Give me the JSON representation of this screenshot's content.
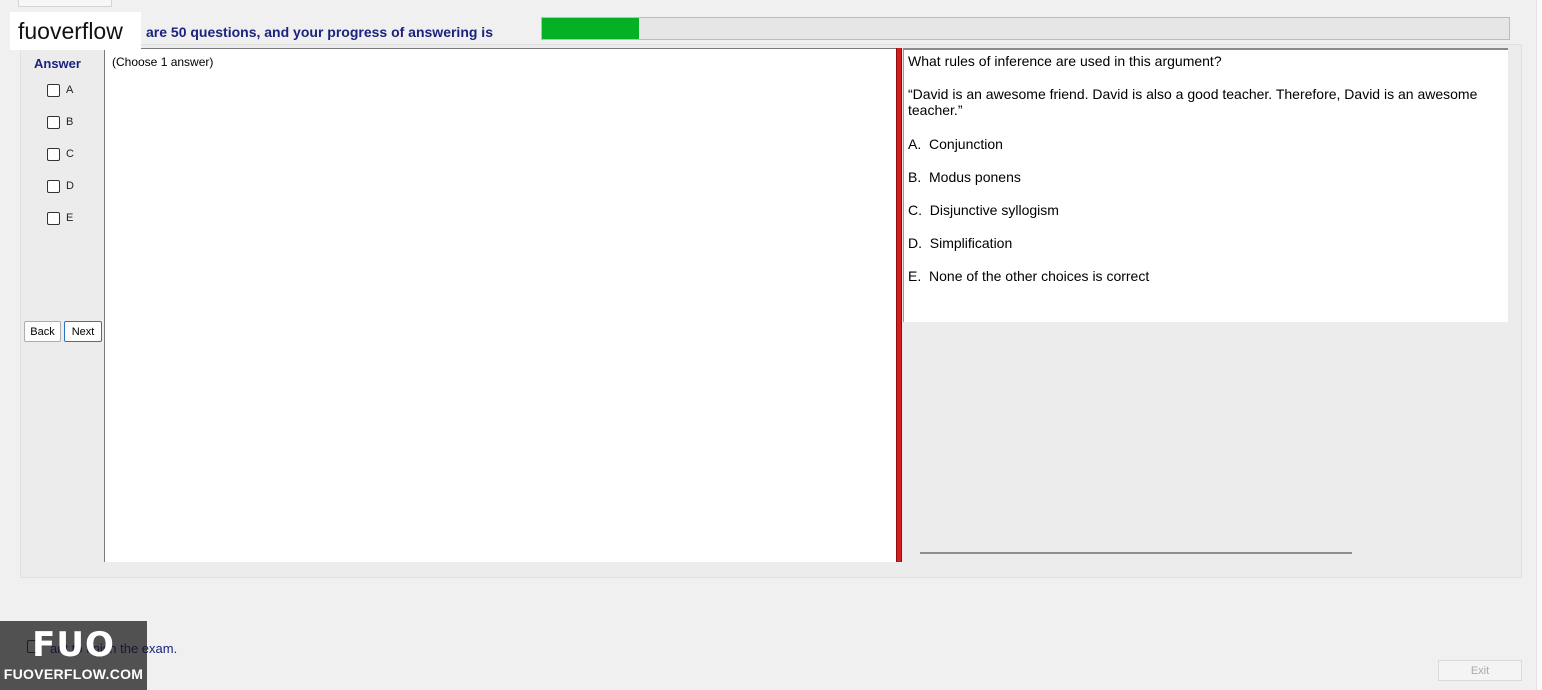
{
  "brand": {
    "logo_text": "fuoverflow"
  },
  "progress": {
    "label": "are 50 questions, and your progress of answering is",
    "fraction": 0.1,
    "fill_color": "#06b025"
  },
  "answer_panel": {
    "title": "Answer",
    "options": [
      "A",
      "B",
      "C",
      "D",
      "E"
    ],
    "back_label": "Back",
    "next_label": "Next"
  },
  "answer_area": {
    "hint": "(Choose 1 answer)"
  },
  "question": {
    "text": "What rules of inference are used in this argument?",
    "quote": "“David is an awesome friend. David is also a good teacher. Therefore, David is an awesome teacher.”",
    "choices": [
      {
        "letter": "A.",
        "text": "Conjunction"
      },
      {
        "letter": "B.",
        "text": "Modus ponens"
      },
      {
        "letter": "C.",
        "text": "Disjunctive syllogism"
      },
      {
        "letter": "D.",
        "text": "Simplification"
      },
      {
        "letter": "E.",
        "text": "None of the other choices is correct"
      }
    ]
  },
  "footer": {
    "finish_label": "ant to finish the exam.",
    "exit_label": "Exit",
    "badge_big": "FUO",
    "badge_small": "FUOVERFLOW.COM"
  },
  "colors": {
    "splitter": "#d81b1b",
    "heading": "#1a237e"
  }
}
